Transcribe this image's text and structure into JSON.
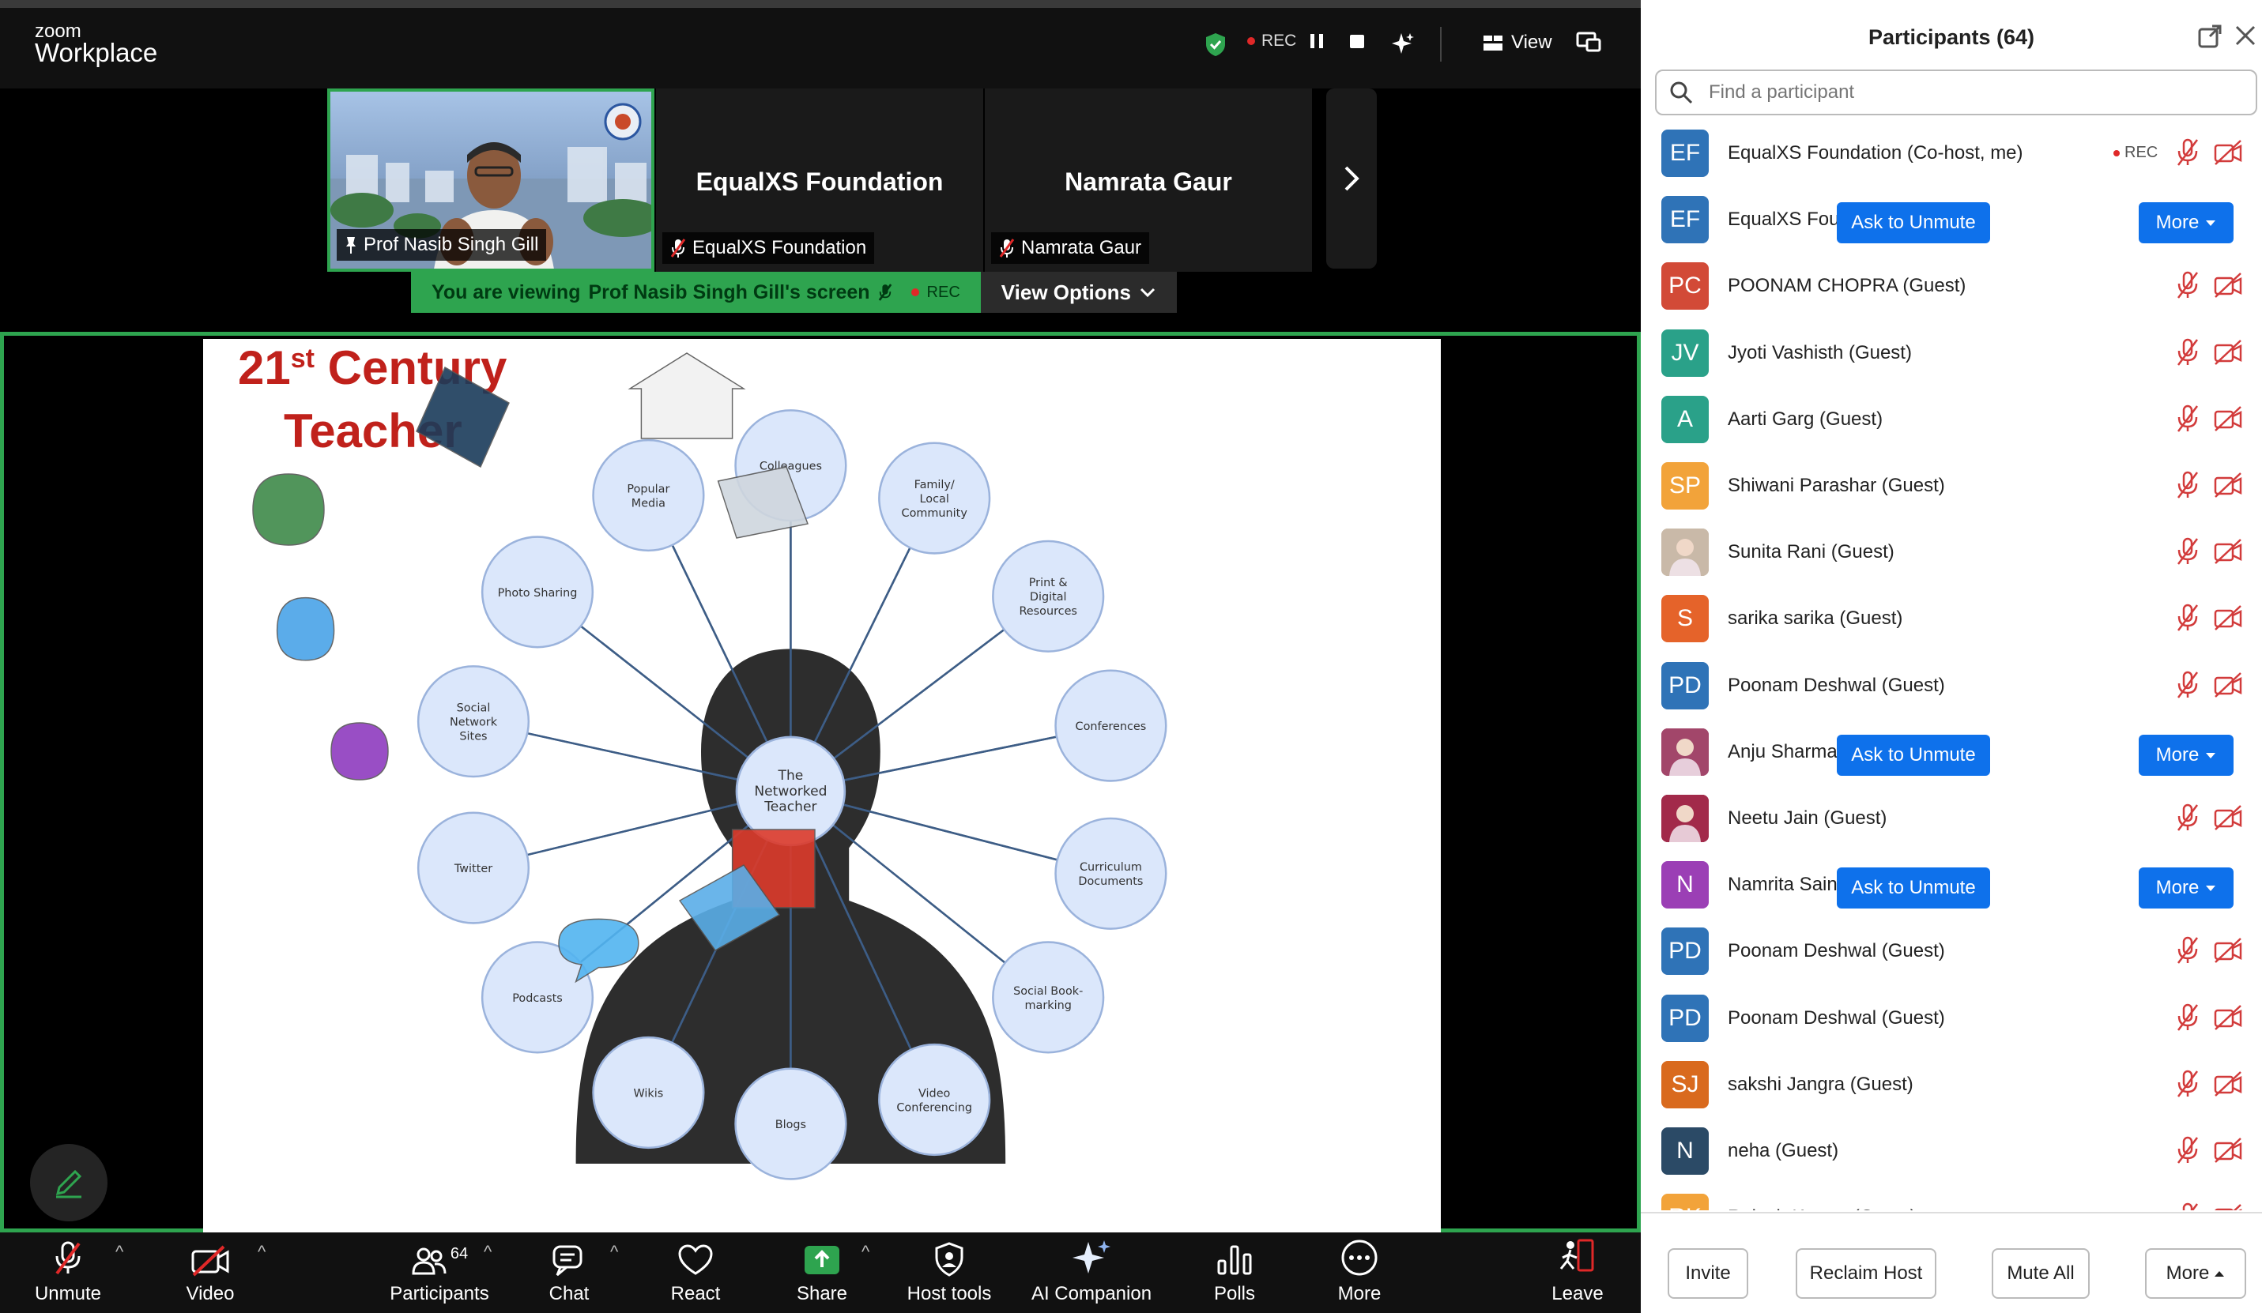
{
  "app": {
    "brand_small": "zoom",
    "brand_big": "Workplace"
  },
  "top_controls": {
    "rec_label": "REC",
    "view_label": "View"
  },
  "thumbnails": [
    {
      "name": "Prof Nasib Singh Gill",
      "video": true,
      "pinned": true
    },
    {
      "name": "EqualXS Foundation",
      "center_name": "EqualXS Foundation",
      "muted": true
    },
    {
      "name": "Namrata Gaur",
      "center_name": "Namrata Gaur",
      "muted": true
    }
  ],
  "viewing_bar": {
    "text_prefix": "You are viewing",
    "text_name": "Prof Nasib Singh Gill's screen",
    "rec": "REC",
    "options_label": "View Options"
  },
  "slide": {
    "title_line1": "21",
    "title_sup": "st",
    "title_line1_rest": " Century",
    "title_line2": "Teacher",
    "center_label_lines": [
      "The",
      "Networked",
      "Teacher"
    ],
    "nodes": [
      {
        "lines": [
          "Colleagues"
        ]
      },
      {
        "lines": [
          "Family/",
          "Local",
          "Community"
        ]
      },
      {
        "lines": [
          "Print &",
          "Digital",
          "Resources"
        ]
      },
      {
        "lines": [
          "Conferences"
        ]
      },
      {
        "lines": [
          "Curriculum",
          "Documents"
        ]
      },
      {
        "lines": [
          "Social Book-",
          "marking"
        ]
      },
      {
        "lines": [
          "Video",
          "Conferencing"
        ]
      },
      {
        "lines": [
          "Blogs"
        ]
      },
      {
        "lines": [
          "Wikis"
        ]
      },
      {
        "lines": [
          "Podcasts"
        ]
      },
      {
        "lines": [
          "Twitter"
        ]
      },
      {
        "lines": [
          "Social",
          "Network",
          "Sites"
        ]
      },
      {
        "lines": [
          "Photo Sharing"
        ]
      },
      {
        "lines": [
          "Popular",
          "Media"
        ]
      }
    ],
    "colors": {
      "title": "#c0211b",
      "node_fill": "#dbe7fb",
      "node_stroke": "#9bb3dc",
      "spoke": "#3d5d86",
      "head": "#2d2d2d"
    }
  },
  "toolbar": {
    "unmute": "Unmute",
    "video": "Video",
    "participants": "Participants",
    "participants_count": "64",
    "chat": "Chat",
    "react": "React",
    "share": "Share",
    "host_tools": "Host tools",
    "ai_companion": "AI Companion",
    "polls": "Polls",
    "more": "More",
    "leave": "Leave"
  },
  "panel": {
    "title": "Participants (64)",
    "search_placeholder": "Find a participant",
    "participants": [
      {
        "initials": "EF",
        "color": "#2f73b7",
        "name": "EqualXS Foundation (Co-host, me)",
        "rec": "REC",
        "actions": "icons"
      },
      {
        "initials": "EF",
        "color": "#2f73b7",
        "name": "EqualXS Foundation (Host)",
        "actions": "buttons"
      },
      {
        "initials": "PC",
        "color": "#d24a37",
        "name": "POONAM CHOPRA (Guest)",
        "actions": "icons"
      },
      {
        "initials": "JV",
        "color": "#2aa189",
        "name": "Jyoti Vashisth (Guest)",
        "actions": "icons"
      },
      {
        "initials": "A",
        "color": "#2aa189",
        "name": "Aarti Garg (Guest)",
        "actions": "icons"
      },
      {
        "initials": "SP",
        "color": "#f2a33a",
        "name": "Shiwani Parashar (Guest)",
        "actions": "icons"
      },
      {
        "initials": "",
        "color": "#c9b9a8",
        "name": "Sunita Rani (Guest)",
        "actions": "icons",
        "photo": true
      },
      {
        "initials": "S",
        "color": "#e5632a",
        "name": "sarika sarika (Guest)",
        "actions": "icons"
      },
      {
        "initials": "PD",
        "color": "#2f73b7",
        "name": "Poonam Deshwal (Guest)",
        "actions": "icons"
      },
      {
        "initials": "",
        "color": "#a2466a",
        "name": "Anju Sharma (Guest)",
        "actions": "buttons",
        "photo": true
      },
      {
        "initials": "",
        "color": "#a22a4a",
        "name": "Neetu Jain (Guest)",
        "actions": "icons",
        "photo": true
      },
      {
        "initials": "N",
        "color": "#9b3fb5",
        "name": "Namrita Saini (Guest)",
        "actions": "buttons"
      },
      {
        "initials": "PD",
        "color": "#2f73b7",
        "name": "Poonam Deshwal (Guest)",
        "actions": "icons"
      },
      {
        "initials": "PD",
        "color": "#2f73b7",
        "name": "Poonam Deshwal (Guest)",
        "actions": "icons"
      },
      {
        "initials": "SJ",
        "color": "#d96a1e",
        "name": "sakshi Jangra (Guest)",
        "actions": "icons"
      },
      {
        "initials": "N",
        "color": "#2b4a66",
        "name": "neha (Guest)",
        "actions": "icons"
      },
      {
        "initials": "RK",
        "color": "#f2a33a",
        "name": "Rajesh Kumar (Guest)",
        "actions": "icons"
      }
    ],
    "ask_to_unmute": "Ask to Unmute",
    "more": "More",
    "footer": {
      "invite": "Invite",
      "reclaim_host": "Reclaim Host",
      "mute_all": "Mute All",
      "more": "More"
    }
  }
}
